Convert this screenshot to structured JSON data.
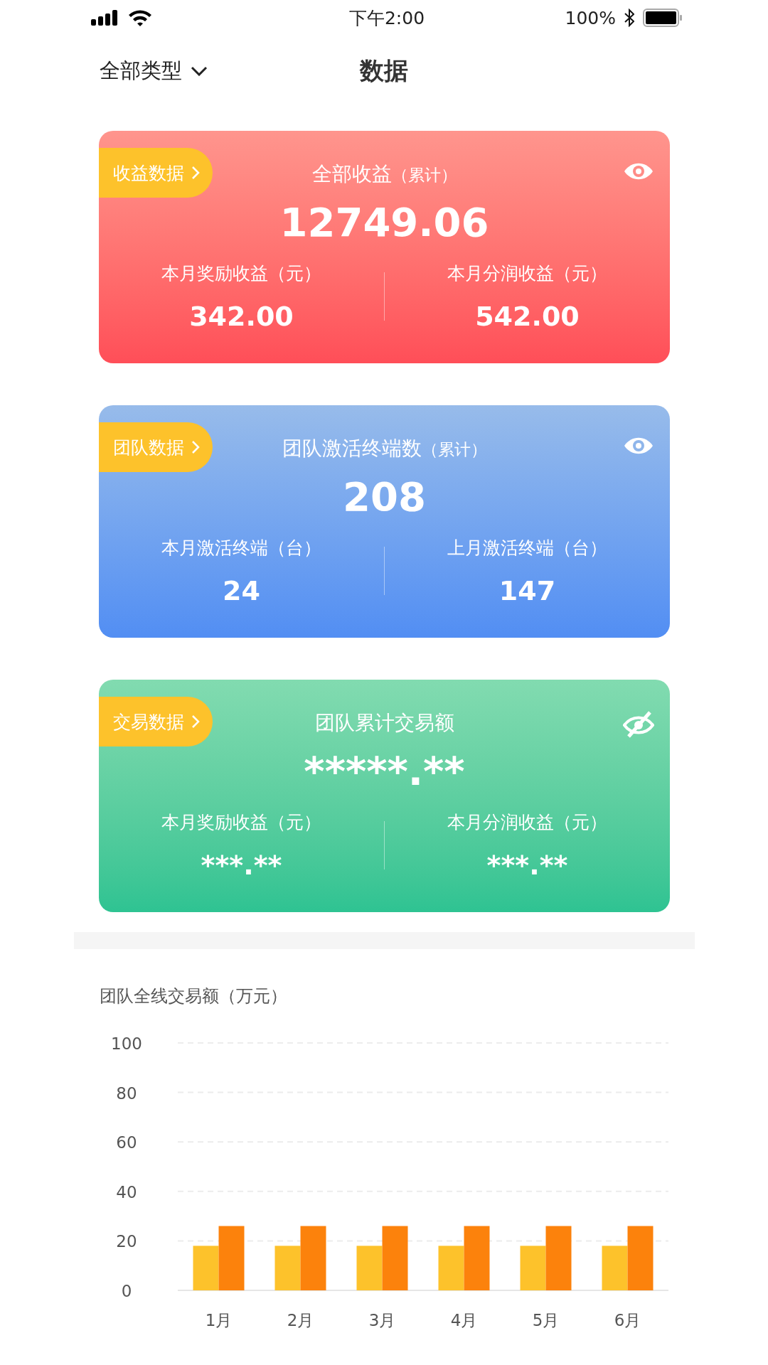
{
  "status_bar": {
    "time": "下午2:00",
    "battery": "100%"
  },
  "header": {
    "filter": "全部类型",
    "title": "数据"
  },
  "cards": [
    {
      "color": "#ff4e58",
      "tag": "收益数据",
      "title": "全部收益",
      "note": "（累计）",
      "hidden": false,
      "value": "12749.06",
      "stats": [
        {
          "label": "本月奖励收益（元）",
          "value": "342.00"
        },
        {
          "label": "本月分润收益（元）",
          "value": "542.00"
        }
      ]
    },
    {
      "color": "#528ef3",
      "tag": "团队数据",
      "title": "团队激活终端数",
      "note": "（累计）",
      "hidden": false,
      "value": "208",
      "stats": [
        {
          "label": "本月激活终端（台）",
          "value": "24"
        },
        {
          "label": "上月激活终端（台）",
          "value": "147"
        }
      ]
    },
    {
      "color": "#2ec392",
      "tag": "交易数据",
      "title": "团队累计交易额",
      "hidden": true,
      "value": "*****.**",
      "stats": [
        {
          "label": "本月奖励收益（元）",
          "value": "***.**"
        },
        {
          "label": "本月分润收益（元）",
          "value": "***.**"
        }
      ]
    }
  ],
  "chart": {
    "chart_data": {
      "type": "bar",
      "title": "团队全线交易额（万元）",
      "categories": [
        "1月",
        "2月",
        "3月",
        "4月",
        "5月",
        "6月"
      ],
      "series": [
        {
          "color": "#fdc22b",
          "values": [
            18,
            18,
            18,
            18,
            18,
            18
          ]
        },
        {
          "color": "#fc820c",
          "values": [
            26,
            26,
            26,
            26,
            26,
            26
          ]
        }
      ],
      "grid": true,
      "ylim": [
        0,
        100
      ],
      "yticks": [
        0,
        20,
        40,
        60,
        80,
        100
      ]
    }
  }
}
